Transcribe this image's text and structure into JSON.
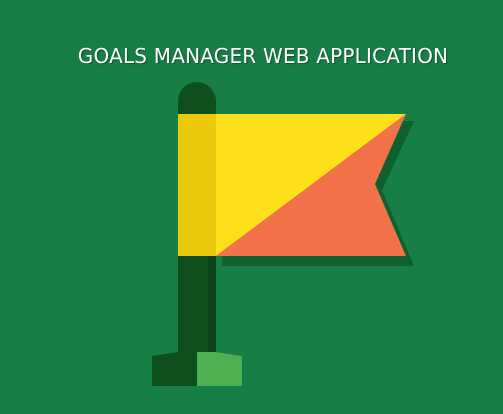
{
  "header": {
    "title": "GOALS MANAGER WEB APPLICATION"
  },
  "illustration": {
    "icon": "flag-icon",
    "colors": {
      "background": "#177f45",
      "pole": "#0f4f1e",
      "pole_shadow": "#0b3d16",
      "pole_cap": "#0f4f1e",
      "base": "#0f4f1e",
      "base_highlight": "#4caf50",
      "flag_yellow": "#fde01a",
      "flag_yellow_shade": "#e9c90a",
      "flag_orange": "#f4724a",
      "flag_shadow": "#0d5a2b"
    }
  }
}
